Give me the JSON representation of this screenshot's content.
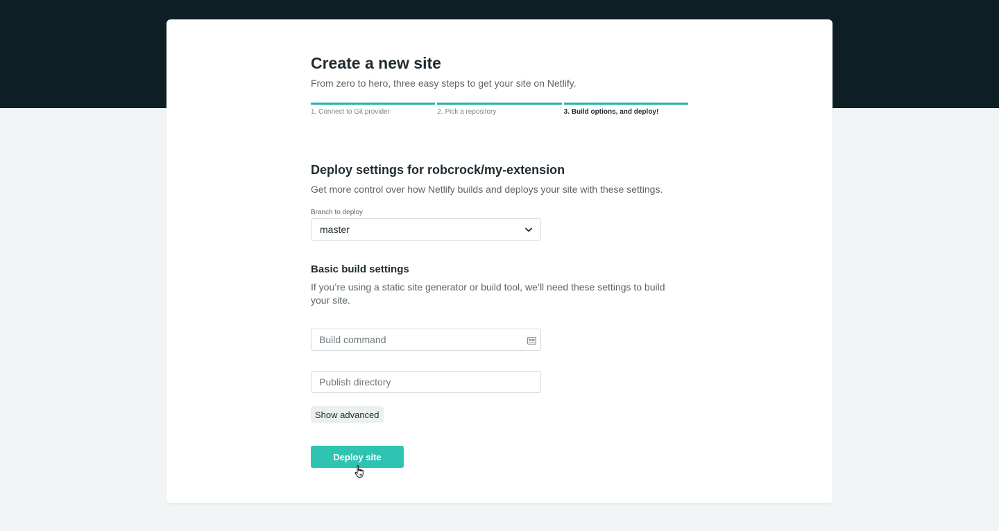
{
  "header": {
    "title": "Create a new site",
    "subtitle": "From zero to hero, three easy steps to get your site on Netlify."
  },
  "steps": [
    {
      "label": "1. Connect to Git provider",
      "active": false
    },
    {
      "label": "2. Pick a repository",
      "active": false
    },
    {
      "label": "3. Build options, and deploy!",
      "active": true
    }
  ],
  "deploy_settings": {
    "title": "Deploy settings for robcrock/my-extension",
    "description": "Get more control over how Netlify builds and deploys your site with these settings.",
    "branch_label": "Branch to deploy",
    "branch_value": "master"
  },
  "build_settings": {
    "title": "Basic build settings",
    "description": "If you’re using a static site generator or build tool, we’ll need these settings to build your site.",
    "build_command_placeholder": "Build command",
    "publish_directory_placeholder": "Publish directory",
    "show_advanced_label": "Show advanced"
  },
  "actions": {
    "deploy_label": "Deploy site"
  },
  "colors": {
    "accent": "#20b3a5",
    "button": "#2fc4b2",
    "hero": "#0e1e25",
    "background": "#f2f5f6"
  },
  "icons": {
    "select": "chevron-down-icon",
    "build_command": "keyboard-icon",
    "cursor": "hand-pointer-cursor-icon"
  }
}
